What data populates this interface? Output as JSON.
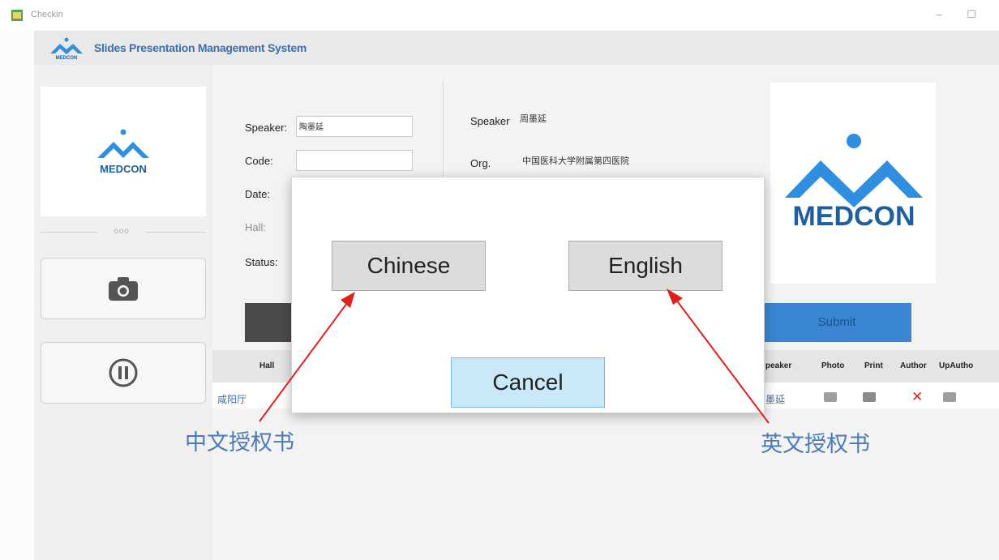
{
  "window": {
    "title": "Checkin",
    "minimize_glyph": "–",
    "maximize_glyph": "☐"
  },
  "header": {
    "title": "Slides Presentation Management System",
    "logo_text": "MEDCON"
  },
  "left_panel": {
    "logo_text": "MEDCON",
    "separator_text": "ooo",
    "camera_button_icon": "camera-icon",
    "pause_button_icon": "pause-icon"
  },
  "form": {
    "speaker_label": "Speaker:",
    "speaker_value": "陶墨延",
    "code_label": "Code:",
    "code_value": "",
    "date_label": "Date:",
    "hall_label": "Hall:",
    "status_label": "Status:"
  },
  "info": {
    "speaker_label": "Speaker",
    "speaker_value": "周墨延",
    "org_label": "Org.",
    "org_value": "中国医科大学附属第四医院"
  },
  "big_logo_text": "MEDCON",
  "submit_label": "Submit",
  "table": {
    "columns": {
      "hall": "Hall",
      "speaker": "peaker",
      "photo": "Photo",
      "print": "Print",
      "author": "Author",
      "upauthor": "UpAutho"
    },
    "rows": [
      {
        "hall": "咸阳厅",
        "speaker": "墨延",
        "delete_glyph": "✕"
      }
    ]
  },
  "dialog": {
    "chinese_label": "Chinese",
    "english_label": "English",
    "cancel_label": "Cancel"
  },
  "annotations": {
    "left": "中文授权书",
    "right": "英文授权书"
  },
  "colors": {
    "brand_blue": "#3a6fb0",
    "logo_blue": "#2f8ee0",
    "submit_blue": "#3a86d4",
    "cancel_bg": "#c9e8f8",
    "arrow_red": "#e0201c"
  }
}
